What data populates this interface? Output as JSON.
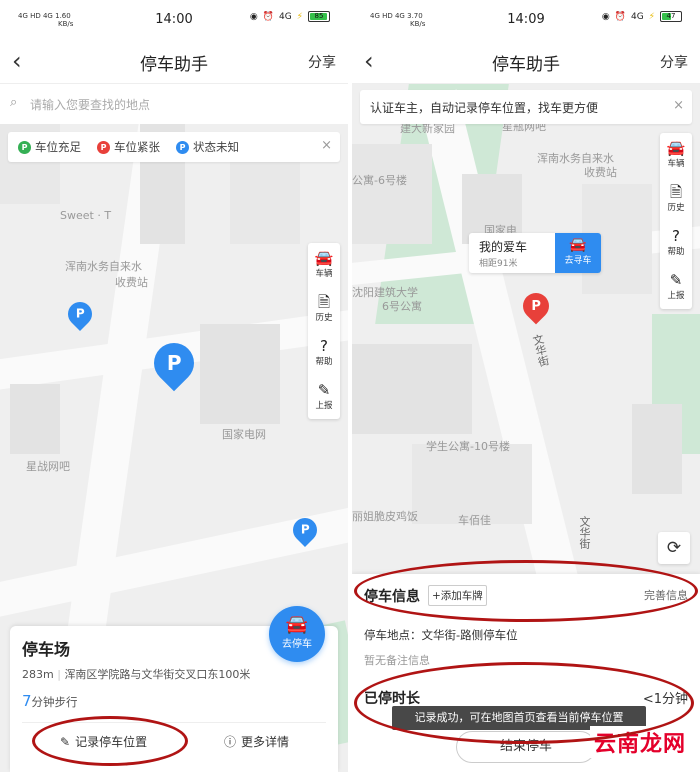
{
  "left": {
    "status": {
      "network": "4G HD 4G",
      "speed": "1.60",
      "speed_unit": "KB/s",
      "time": "14:00",
      "battery": "85"
    },
    "nav": {
      "back": "‹",
      "title": "停车助手",
      "share": "分享"
    },
    "search": {
      "placeholder": "请输入您要查找的地点"
    },
    "legend": {
      "available": "车位充足",
      "tight": "车位紧张",
      "unknown": "状态未知",
      "close": "×"
    },
    "map_labels": {
      "sweet": "Sweet · T",
      "water": "浑南水务自来水",
      "water2": "收费站",
      "grid": "国家电网",
      "bar": "星战网吧"
    },
    "tools": [
      {
        "icon": "🚘",
        "label": "车辆"
      },
      {
        "icon": "🗎",
        "label": "历史"
      },
      {
        "icon": "?",
        "label": "帮助"
      },
      {
        "icon": "✎",
        "label": "上报"
      }
    ],
    "go_button": {
      "icon": "🚘",
      "label": "去停车"
    },
    "card": {
      "name": "停车场",
      "distance": "283m",
      "address": "浑南区学院路与文华街交叉口东100米",
      "walk_minutes": "7",
      "walk_suffix": "分钟步行",
      "record_label": "记录停车位置",
      "details_label": "更多详情"
    }
  },
  "right": {
    "status": {
      "network": "4G HD 4G",
      "speed": "3.70",
      "speed_unit": "KB/s",
      "time": "14:09",
      "battery": "47"
    },
    "nav": {
      "back": "‹",
      "title": "停车助手",
      "share": "分享"
    },
    "banner": {
      "text": "认证车主，自动记录停车位置，找车更方便",
      "close": "×"
    },
    "map_labels": {
      "top": "建大新家园",
      "top2": "星瓶网吧",
      "water": "浑南水务自来水",
      "water2": "收费站",
      "apt6": "公寓-6号楼",
      "home": "国家电",
      "univ": "沈阳建筑大学",
      "univ2": "6号公寓",
      "street": "文华街",
      "apt10": "学生公寓-10号楼",
      "shop": "丽姐脆皮鸡饭",
      "car": "车佰佳",
      "street2": "文华街"
    },
    "car_card": {
      "title": "我的爱车",
      "distance": "相距91米",
      "find_icon": "🚘",
      "find_label": "去寻车"
    },
    "tools": [
      {
        "icon": "🚘",
        "label": "车辆"
      },
      {
        "icon": "🗎",
        "label": "历史"
      },
      {
        "icon": "?",
        "label": "帮助"
      },
      {
        "icon": "✎",
        "label": "上报"
      }
    ],
    "refresh_icon": "⟳",
    "panel": {
      "title": "停车信息",
      "add_plate": "+添加车牌",
      "complete": "完善信息",
      "location": "停车地点：文华街-路侧停车位",
      "note": "暂无备注信息",
      "duration_label": "已停时长",
      "duration_value": "<1分钟"
    },
    "toast": "记录成功，可在地图首页查看当前停车位置",
    "end_button": "结束停车",
    "watermark": "云南龙网"
  },
  "colors": {
    "accent": "#2f8cf0",
    "green_pin": "#35b055",
    "red_pin": "#e8403a",
    "blue_pin": "#2f8cf0",
    "oval": "#b01414"
  }
}
